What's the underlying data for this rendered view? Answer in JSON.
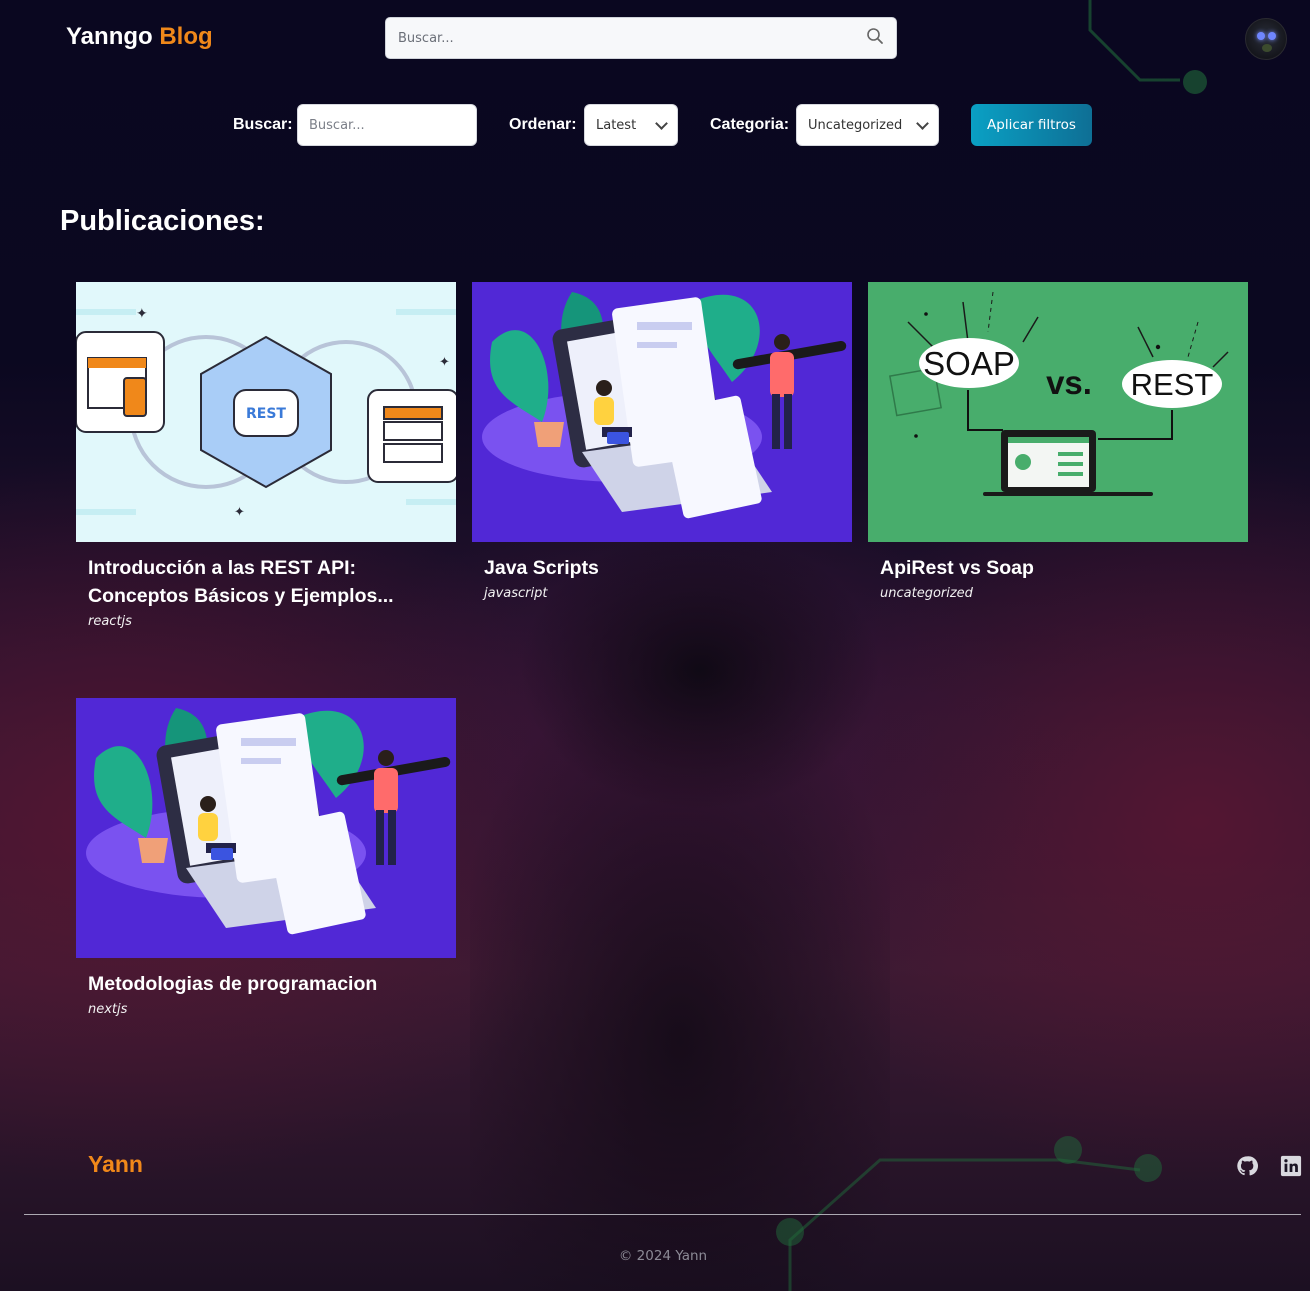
{
  "header": {
    "brand_part1": "Yanngo",
    "brand_part2": "Blog",
    "search_placeholder": "Buscar...",
    "search_icon": "search-icon"
  },
  "filters": {
    "search_label": "Buscar:",
    "search_placeholder": "Buscar...",
    "order_label": "Ordenar:",
    "order_value": "Latest",
    "category_label": "Categoria:",
    "category_value": "Uncategorized",
    "apply_label": "Aplicar filtros"
  },
  "main": {
    "title": "Publicaciones:",
    "posts": [
      {
        "title": "Introducción a las REST API: Conceptos Básicos y Ejemplos...",
        "tag": "reactjs",
        "image": "rest-api-illustration"
      },
      {
        "title": "Java Scripts",
        "tag": "javascript",
        "image": "laptop-documents-illustration"
      },
      {
        "title": "ApiRest vs Soap",
        "tag": "uncategorized",
        "image": "soap-vs-rest-illustration",
        "img_words": [
          "SOAP",
          "vs.",
          "REST"
        ]
      },
      {
        "title": "Metodologias de programacion",
        "tag": "nextjs",
        "image": "laptop-documents-illustration"
      }
    ]
  },
  "footer": {
    "brand": "Yann",
    "copyright": "© 2024 Yann",
    "icons": [
      "github-icon",
      "linkedin-icon"
    ]
  },
  "colors": {
    "accent_orange": "#f0881a",
    "button_teal": "#0aa0c4",
    "background": "#0b0820"
  }
}
